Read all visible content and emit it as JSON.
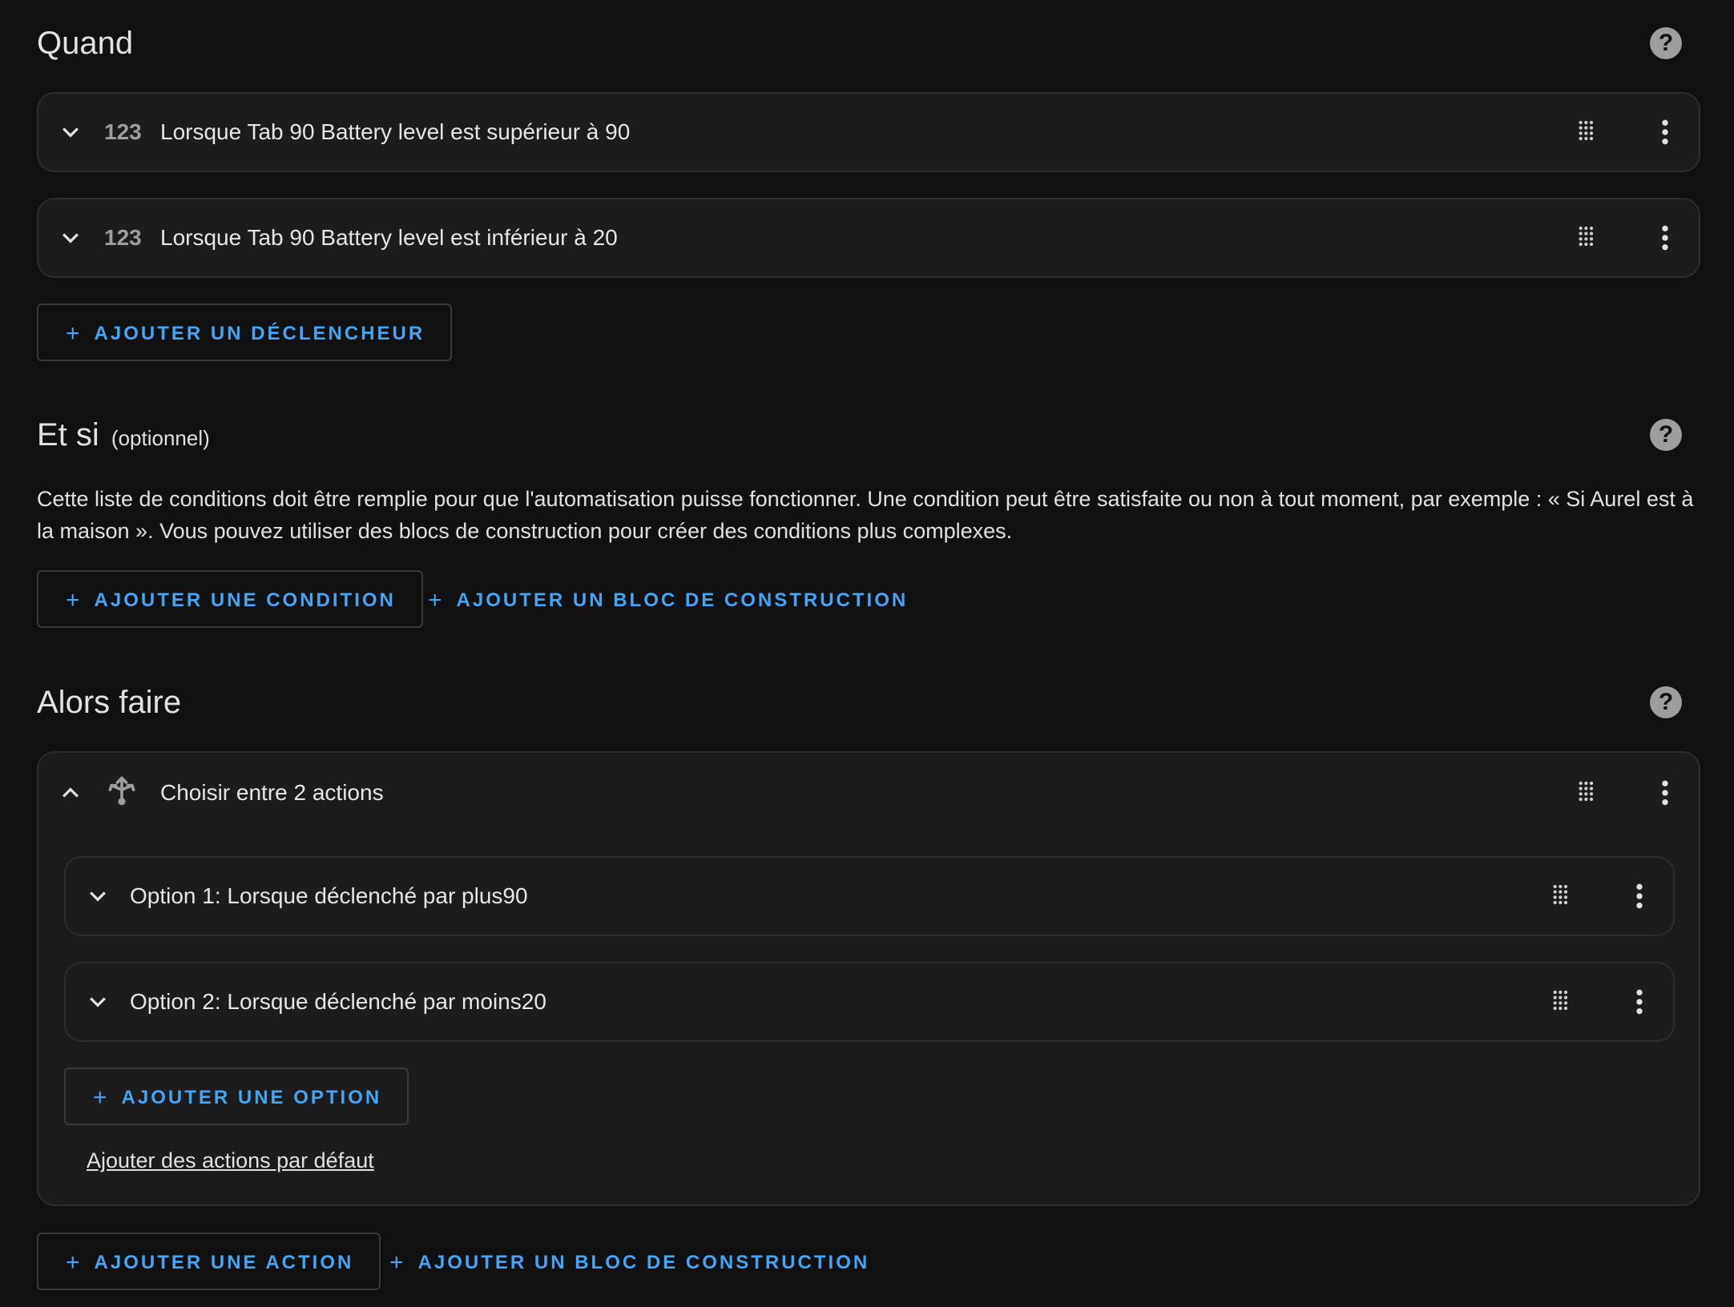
{
  "triggers": {
    "title": "Quand",
    "items": [
      {
        "icon": "123",
        "label": "Lorsque Tab 90 Battery level est supérieur à 90"
      },
      {
        "icon": "123",
        "label": "Lorsque Tab 90 Battery level est inférieur à 20"
      }
    ],
    "add_label": "AJOUTER UN DÉCLENCHEUR"
  },
  "conditions": {
    "title": "Et si",
    "optional_label": "(optionnel)",
    "description": "Cette liste de conditions doit être remplie pour que l'automatisation puisse fonctionner. Une condition peut être satisfaite ou non à tout moment, par exemple : « Si Aurel est à la maison ». Vous pouvez utiliser des blocs de construction pour créer des conditions plus complexes.",
    "add_condition_label": "AJOUTER UNE CONDITION",
    "add_block_label": "AJOUTER UN BLOC DE CONSTRUCTION"
  },
  "actions": {
    "title": "Alors faire",
    "choose": {
      "label": "Choisir entre 2 actions",
      "options": [
        {
          "label": "Option 1: Lorsque déclenché par plus90"
        },
        {
          "label": "Option 2: Lorsque déclenché par moins20"
        }
      ],
      "add_option_label": "AJOUTER UNE OPTION",
      "default_actions_link": "Ajouter des actions par défaut"
    },
    "add_action_label": "AJOUTER UNE ACTION",
    "add_block_label": "AJOUTER UN BLOC DE CONSTRUCTION"
  },
  "icons": {
    "help": "?",
    "plus": "+"
  },
  "colors": {
    "background": "#111111",
    "card": "#1c1c1c",
    "border": "#2e2e2e",
    "accent": "#42a5f5",
    "icon": "#9e9e9e"
  }
}
